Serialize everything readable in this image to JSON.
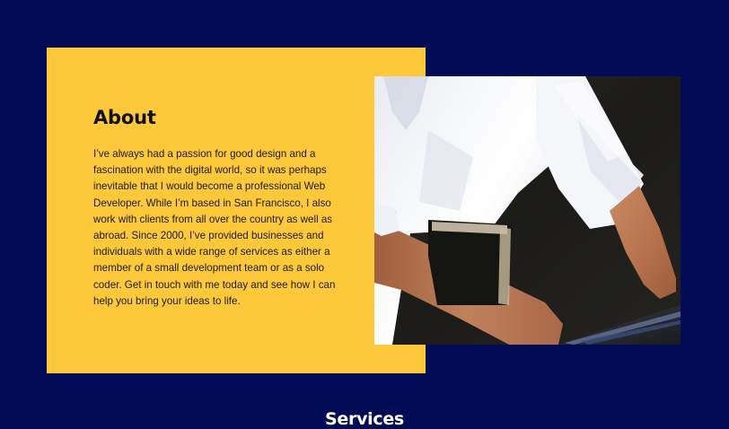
{
  "about": {
    "title": "About",
    "body": "I’ve always had a passion for good design and a fascination with the digital world, so it was perhaps inevitable that I would become a professional Web Developer. While I’m based in San Francisco, I also work with clients from all over the country as well as abroad. Since 2000, I’ve provided businesses and individuals with a wide range of services as either a member of a small development team or as a solo coder. Get in touch with me today and see how I can help you bring your ideas to life."
  },
  "photo": {
    "icon": "person-at-laptop-photo"
  },
  "services": {
    "heading": "Services"
  },
  "colors": {
    "page_background": "#020b55",
    "card_background": "#fec83b",
    "text_dark": "#111111",
    "text_light": "#ffffff"
  }
}
